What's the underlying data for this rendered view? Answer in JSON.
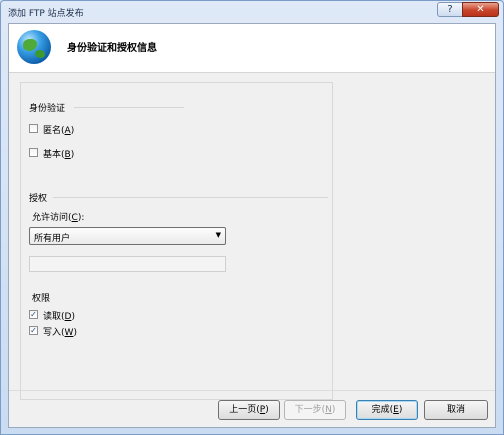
{
  "window": {
    "title": "添加 FTP 站点发布",
    "help_label": "?",
    "close_label": "✕"
  },
  "header": {
    "title": "身份验证和授权信息"
  },
  "authentication": {
    "group_title": "身份验证",
    "anonymous": {
      "label": "匿名",
      "mnemonic": "A",
      "checked": false
    },
    "basic": {
      "label": "基本",
      "mnemonic": "B",
      "checked": false
    }
  },
  "authorization": {
    "group_title": "授权",
    "access_label": "允许访问",
    "access_mnemonic": "C",
    "access_value": "所有用户",
    "access_text": ""
  },
  "permissions": {
    "group_title": "权限",
    "read": {
      "label": "读取",
      "mnemonic": "D",
      "checked": true
    },
    "write": {
      "label": "写入",
      "mnemonic": "W",
      "checked": true
    }
  },
  "buttons": {
    "prev": {
      "label": "上一页",
      "mnemonic": "P"
    },
    "next": {
      "label": "下一步",
      "mnemonic": "N"
    },
    "finish": {
      "label": "完成",
      "mnemonic": "E"
    },
    "cancel": {
      "label": "取消"
    }
  }
}
